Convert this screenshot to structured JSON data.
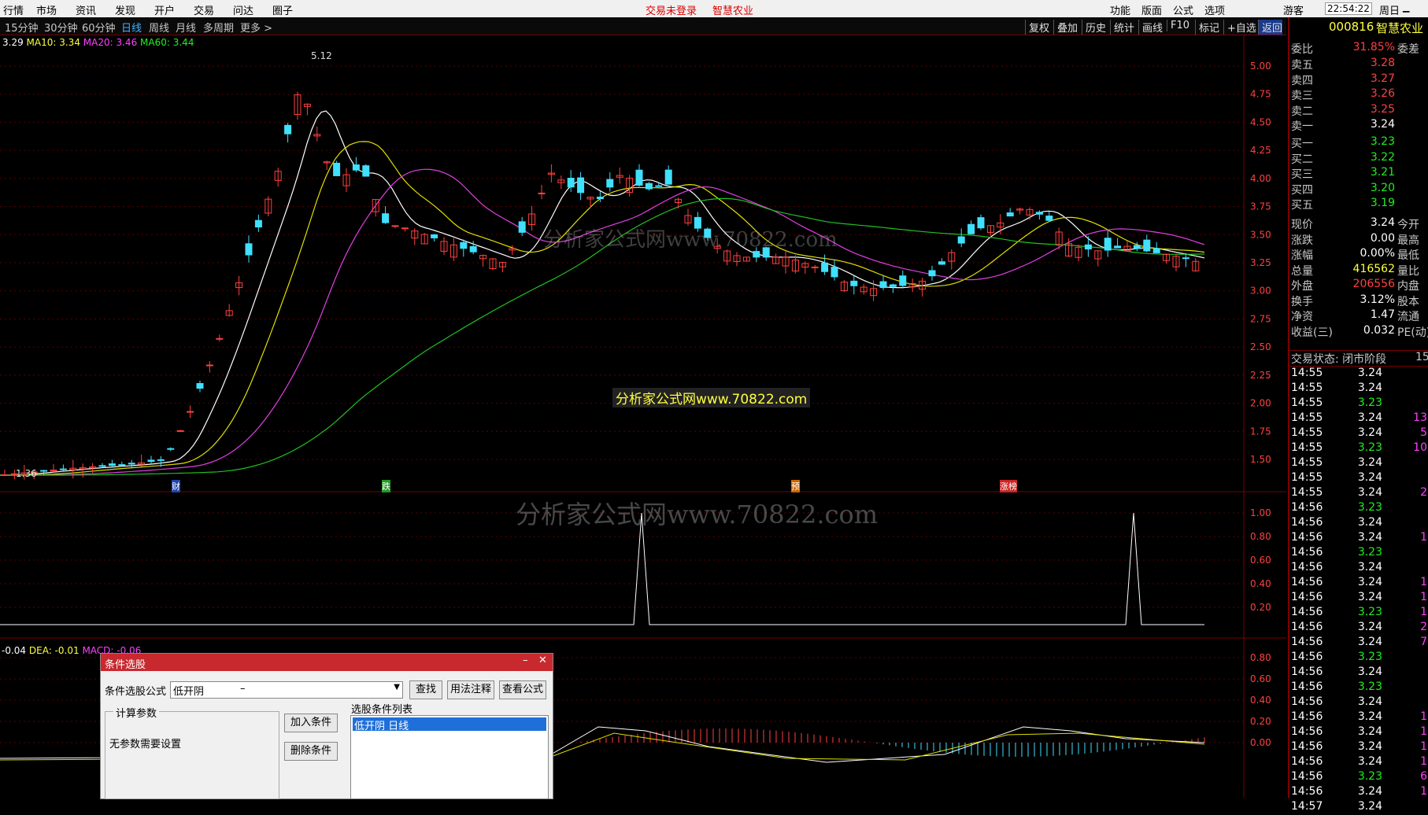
{
  "topbar": {
    "menus": [
      "行情",
      "市场",
      "资讯",
      "发现",
      "开户",
      "交易",
      "问达"
    ],
    "menu_extra": "圈子",
    "login": "交易未登录",
    "stock_name_top": "智慧农业",
    "right_menus": [
      "功能",
      "版面",
      "公式",
      "选项"
    ],
    "user": "游客",
    "time": "22:54:22",
    "weekday": "周日"
  },
  "timeframes": [
    "15分钟",
    "30分钟",
    "60分钟",
    "日线",
    "周线",
    "月线",
    "多周期",
    "更多 >"
  ],
  "active_timeframe": "日线",
  "toolbar": [
    "复权",
    "叠加",
    "历史",
    "统计",
    "画线",
    "F10",
    "标记",
    "+自选",
    "返回"
  ],
  "ma_legend": {
    "price": "3.29",
    "ma10": "MA10: 3.34",
    "ma20": "MA20: 3.46",
    "ma60": "MA60: 3.44"
  },
  "colors": {
    "up": "#ff4040",
    "down": "#40e0ff",
    "ma10": "#ffffff",
    "ma20": "#e0e000",
    "ma60": "#e040e0",
    "ma_long": "#20c020",
    "border": "#7a0000"
  },
  "chart_marks": {
    "high": "5.12",
    "low": "1.36"
  },
  "event_tags": [
    "财",
    "跌",
    "预",
    "涨榜"
  ],
  "watermark_center": "分析家公式网www.70822.com",
  "watermark_main": "分析家公式网www.70822.com",
  "watermark_mid": "分析家公式网www.70822.com",
  "y_axis_price": [
    "5.00",
    "4.75",
    "4.50",
    "4.25",
    "4.00",
    "3.75",
    "3.50",
    "3.25",
    "3.00",
    "2.75",
    "2.50",
    "2.25",
    "2.00",
    "1.75",
    "1.50"
  ],
  "y_axis_ind": [
    "1.00",
    "0.80",
    "0.60",
    "0.40",
    "0.20"
  ],
  "y_axis_macd": [
    "0.80",
    "0.60",
    "0.40",
    "0.20",
    "0.00"
  ],
  "macd_legend": {
    "dif": "-0.04",
    "dea": "DEA: -0.01",
    "macd": "MACD: -0.06"
  },
  "panel": {
    "code": "000816",
    "name": "智慧农业",
    "weibi_label": "委比",
    "weibi": "31.85%",
    "weicha": "委差",
    "sells": [
      [
        "卖五",
        "3.28"
      ],
      [
        "卖四",
        "3.27"
      ],
      [
        "卖三",
        "3.26"
      ],
      [
        "卖二",
        "3.25"
      ],
      [
        "卖一",
        "3.24"
      ]
    ],
    "buys": [
      [
        "买一",
        "3.23"
      ],
      [
        "买二",
        "3.22"
      ],
      [
        "买三",
        "3.21"
      ],
      [
        "买四",
        "3.20"
      ],
      [
        "买五",
        "3.19"
      ]
    ],
    "stats": [
      [
        "现价",
        "3.24",
        "今开"
      ],
      [
        "涨跌",
        "0.00",
        "最高"
      ],
      [
        "涨幅",
        "0.00%",
        "最低"
      ],
      [
        "总量",
        "416562",
        "量比"
      ],
      [
        "外盘",
        "206556",
        "内盘"
      ],
      [
        "换手",
        "3.12%",
        "股本"
      ],
      [
        "净资",
        "1.47",
        "流通"
      ],
      [
        "收益(三)",
        "0.032",
        "PE(动)"
      ]
    ],
    "trade_status": "交易状态: 闭市阶段",
    "trade_status_extra": "15:",
    "ticks": [
      [
        "14:55",
        "3.24",
        ""
      ],
      [
        "14:55",
        "3.24",
        ""
      ],
      [
        "14:55",
        "3.23",
        ""
      ],
      [
        "14:55",
        "3.24",
        "13"
      ],
      [
        "14:55",
        "3.24",
        "5"
      ],
      [
        "14:55",
        "3.23",
        "10"
      ],
      [
        "14:55",
        "3.24",
        ""
      ],
      [
        "14:55",
        "3.24",
        ""
      ],
      [
        "14:55",
        "3.24",
        "2"
      ],
      [
        "14:56",
        "3.23",
        ""
      ],
      [
        "14:56",
        "3.24",
        ""
      ],
      [
        "14:56",
        "3.24",
        "1"
      ],
      [
        "14:56",
        "3.23",
        ""
      ],
      [
        "14:56",
        "3.24",
        ""
      ],
      [
        "14:56",
        "3.24",
        "1"
      ],
      [
        "14:56",
        "3.24",
        "1"
      ],
      [
        "14:56",
        "3.23",
        "1"
      ],
      [
        "14:56",
        "3.24",
        "2"
      ],
      [
        "14:56",
        "3.24",
        "7"
      ],
      [
        "14:56",
        "3.23",
        ""
      ],
      [
        "14:56",
        "3.24",
        ""
      ],
      [
        "14:56",
        "3.23",
        ""
      ],
      [
        "14:56",
        "3.24",
        ""
      ],
      [
        "14:56",
        "3.24",
        "1"
      ],
      [
        "14:56",
        "3.24",
        "1"
      ],
      [
        "14:56",
        "3.24",
        "1"
      ],
      [
        "14:56",
        "3.24",
        "1"
      ],
      [
        "14:56",
        "3.23",
        "6"
      ],
      [
        "14:56",
        "3.24",
        "1"
      ],
      [
        "14:57",
        "3.24",
        ""
      ]
    ]
  },
  "dialog": {
    "title": "条件选股",
    "formula_label": "条件选股公式",
    "formula_value": "低开阴",
    "formula_extra": "–",
    "btn_find": "查找",
    "btn_usage": "用法注释",
    "btn_view": "查看公式",
    "params_title": "计算参数",
    "params_text": "无参数需要设置",
    "btn_add": "加入条件",
    "btn_delete": "删除条件",
    "list_title": "选股条件列表",
    "list_item": "低开阴    日线"
  }
}
